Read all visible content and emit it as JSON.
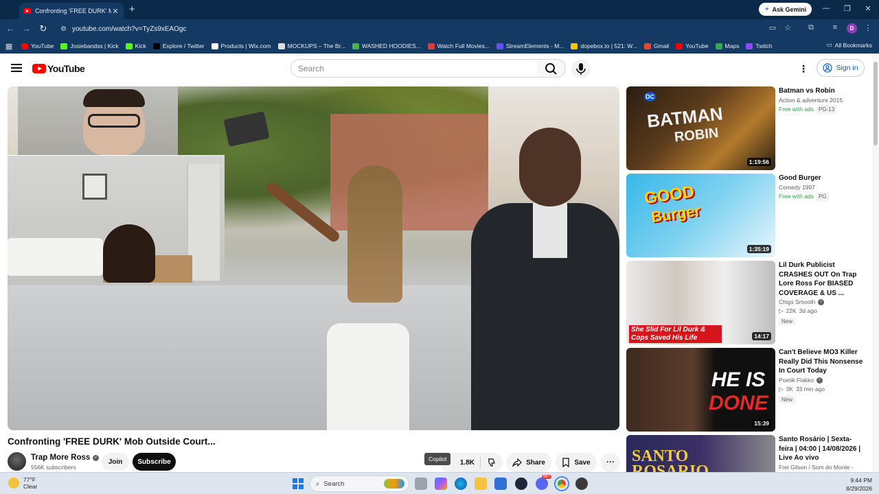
{
  "browser": {
    "tab_title": "Confronting 'FREE DURK' Mob Outside Court...",
    "gemini_label": "Ask Gemini",
    "url": "youtube.com/watch?v=TyZs9xEAOgc",
    "profile_initial": "D",
    "bookmarks": [
      {
        "label": "YouTube",
        "color": "#ff0000"
      },
      {
        "label": "Josiebandss | Kick",
        "color": "#53fc18"
      },
      {
        "label": "Kick",
        "color": "#53fc18"
      },
      {
        "label": "Explore / Twitter",
        "color": "#000000"
      },
      {
        "label": "Products | Wix.com",
        "color": "#ffffff"
      },
      {
        "label": "MOCKUPS – The Br...",
        "color": "#dddddd"
      },
      {
        "label": "WASHED HOODIES...",
        "color": "#4caf50"
      },
      {
        "label": "Watch Full Movies...",
        "color": "#e53935"
      },
      {
        "label": "StreamElements - M...",
        "color": "#6a4cff"
      },
      {
        "label": "dopebox.to | 521: W...",
        "color": "#f7c600"
      },
      {
        "label": "Gmail",
        "color": "#ea4335"
      },
      {
        "label": "YouTube",
        "color": "#ff0000"
      },
      {
        "label": "Maps",
        "color": "#34a853"
      },
      {
        "label": "Twitch",
        "color": "#9146ff"
      }
    ],
    "all_bookmarks": "All Bookmarks"
  },
  "youtube": {
    "logo_text": "YouTube",
    "search_placeholder": "Search",
    "signin_label": "Sign in"
  },
  "video": {
    "title": "Confronting 'FREE DURK' Mob Outside Court...",
    "channel": "Trap More Ross",
    "subscribers": "556K subscribers",
    "join_label": "Join",
    "subscribe_label": "Subscribe",
    "tooltip": "Copilot",
    "likes": "1.8K",
    "share_label": "Share",
    "save_label": "Save"
  },
  "recommendations": [
    {
      "title": "Batman vs Robin",
      "meta1": "Action & adventure 2015",
      "free": "Free with ads",
      "rating": "PG-13",
      "duration": "1:19:56"
    },
    {
      "title": "Good Burger",
      "meta1": "Comedy 1997",
      "free": "Free with ads",
      "rating": "PG",
      "duration": "1:35:19"
    },
    {
      "title": "Lil Durk Publicist CRASHES OUT On Trap Lore Ross For BIASED COVERAGE & US ...",
      "channel": "Chigs Smooth",
      "views": "22K",
      "age": "3d ago",
      "badge": "New",
      "duration": "14:17",
      "thumb_text": "She Slid For Lil Durk & Cops Saved His Life"
    },
    {
      "title": "Can't Believe MO3 Killer Really Did This Nonsense In Court Today",
      "channel": "Poetik Flakko",
      "views": "3K",
      "age": "33 min ago",
      "badge": "New",
      "duration": "15:39",
      "thumb_text_1": "HE IS",
      "thumb_text_2": "DONE"
    },
    {
      "title": "Santo Rosário | Sexta-feira | 04:00 | 14/08/2026 | Live Ao vivo",
      "channel": "Frei Gilson / Som do Monte - OFI...",
      "thumb_text": "SANTO ROSARIO"
    }
  ],
  "taskbar": {
    "temp": "77°F",
    "condition": "Clear",
    "search_label": "Search",
    "time": "9:44 PM",
    "date": "8/29/2026",
    "discord_badge": "99+"
  }
}
